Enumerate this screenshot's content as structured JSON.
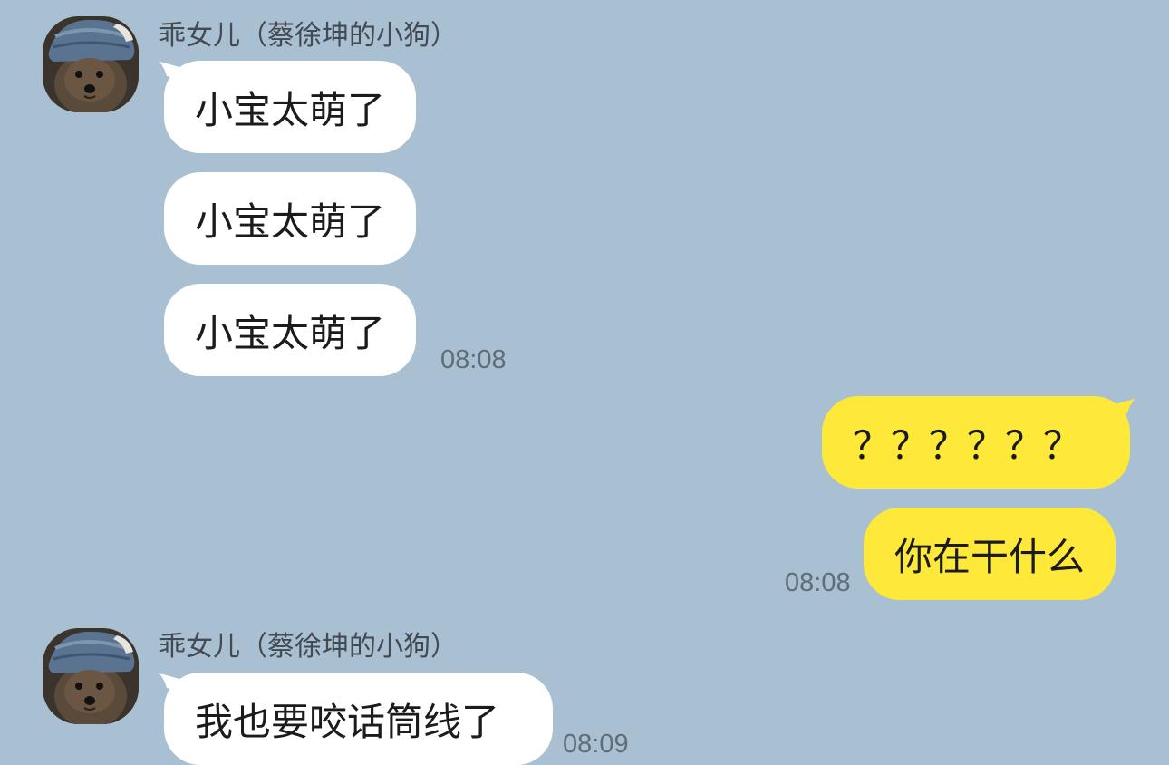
{
  "messages": [
    {
      "sender": "乖女儿（蔡徐坤的小狗）",
      "texts": [
        "小宝太萌了",
        "小宝太萌了",
        "小宝太萌了"
      ],
      "time": "08:08"
    },
    {
      "texts": [
        "？？？？？？",
        "你在干什么"
      ],
      "time": "08:08"
    },
    {
      "sender": "乖女儿（蔡徐坤的小狗）",
      "texts": [
        "我也要咬话筒线了"
      ],
      "time": "08:09"
    }
  ],
  "colors": {
    "background": "#a9bfd2",
    "incoming_bubble": "#ffffff",
    "outgoing_bubble": "#fee93b"
  }
}
